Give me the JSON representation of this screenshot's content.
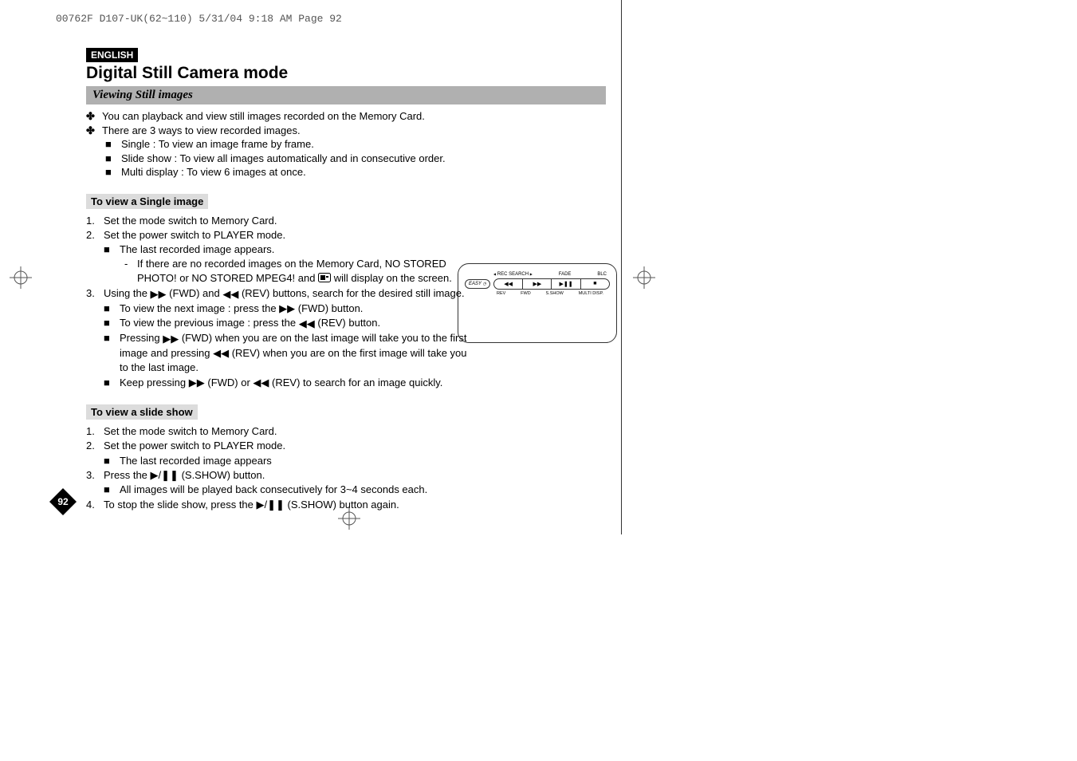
{
  "slug": "00762F D107-UK(62~110)  5/31/04 9:18 AM  Page 92",
  "lang_badge": "ENGLISH",
  "title": "Digital Still Camera mode",
  "section_bar": "Viewing Still images",
  "intro": {
    "line1": "You can playback and view still images recorded on the Memory Card.",
    "line2": "There are 3 ways to view recorded images.",
    "sub1": "Single : To view an image frame by frame.",
    "sub2": "Slide show : To view all images automatically and in consecutive order.",
    "sub3": "Multi display : To view 6 images at once."
  },
  "single": {
    "heading": "To view a Single image",
    "step1": "Set the mode switch to Memory Card.",
    "step2": "Set the power switch to PLAYER mode.",
    "step2_sub1": "The last recorded image appears.",
    "step2_subsub_a": "If there are no recorded images on the Memory Card, NO STORED PHOTO! or NO STORED MPEG4! and ",
    "step2_subsub_b": " will display on the screen.",
    "step3_a": "Using the ",
    "step3_b": " (FWD) and ",
    "step3_c": " (REV) buttons, search for the desired still image.",
    "step3_sub1_a": "To view the next image : press the ",
    "step3_sub1_b": " (FWD) button.",
    "step3_sub2_a": "To view the previous image : press the ",
    "step3_sub2_b": " (REV) button.",
    "step3_sub3_a": "Pressing ",
    "step3_sub3_b": " (FWD) when you are on the last image will take you to the first image and pressing ",
    "step3_sub3_c": " (REV) when you are on the first image will take you to the last image.",
    "step3_sub4_a": "Keep pressing ",
    "step3_sub4_b": " (FWD) or ",
    "step3_sub4_c": " (REV) to search for an image quickly."
  },
  "slide": {
    "heading": "To view a slide show",
    "step1": "Set the mode switch to Memory Card.",
    "step2": "Set the power switch to PLAYER mode.",
    "step2_sub1": "The last recorded image appears",
    "step3_a": "Press the ",
    "step3_b": " (S.SHOW) button.",
    "step3_sub1": "All images will be played back consecutively for 3~4 seconds each.",
    "step4_a": "To stop the slide show, press the ",
    "step4_b": " (S.SHOW) button again."
  },
  "diagram": {
    "easy": "EASY",
    "top1": "REC SEARCH",
    "top2": "FADE",
    "top3": "BLC",
    "b1": "◀◀",
    "b2": "▶▶",
    "b3": "▶❚❚",
    "b4": "■",
    "bot1": "REV",
    "bot2": "FWD",
    "bot3": "S.SHOW",
    "bot4": "MULTI DISP."
  },
  "page_num": "92"
}
